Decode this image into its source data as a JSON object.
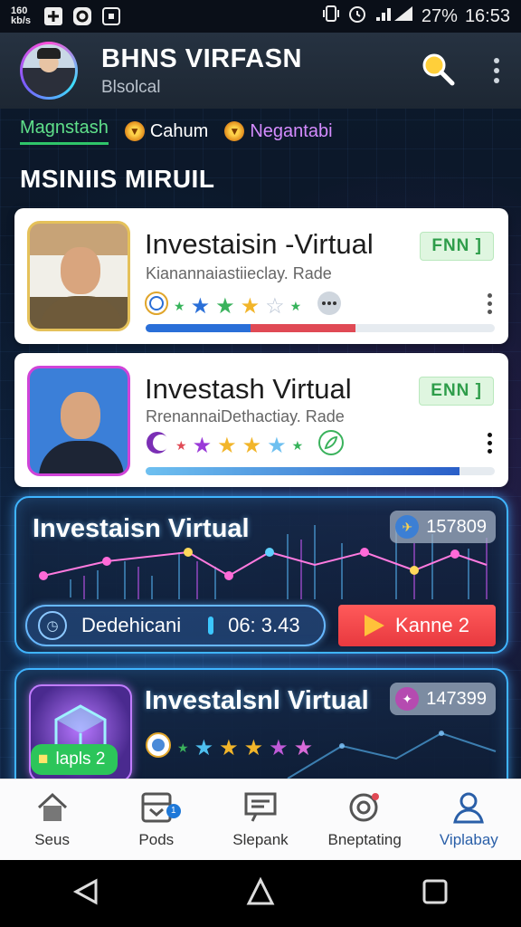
{
  "status_bar": {
    "speed": "160\nkb/s",
    "battery": "27%",
    "time": "16:53"
  },
  "header": {
    "title": "BHNS VIRFASN",
    "subtitle": "Blsolcal"
  },
  "filters": [
    {
      "label": "Magnstash",
      "active": true
    },
    {
      "label": "Cahum",
      "active": false
    },
    {
      "label": "Negantabi",
      "active": false
    }
  ],
  "section_title": "MSINIIS MIRUIL",
  "cards": [
    {
      "title": "Investaisin -Virtual",
      "subtitle": "Kianannaiastiieclay. Rade",
      "badge": "FNN ]",
      "progress": 0.6
    },
    {
      "title": "Investash Virtual",
      "subtitle": "RrenannaiDethactiay. Rade",
      "badge": "ENN ]",
      "progress": 0.9
    }
  ],
  "neon_cards": [
    {
      "title": "Investaisn Virtual",
      "badge_value": "157809",
      "pill_label": "Dedehicani",
      "pill_value": "06: 3.43",
      "button_label": "Kanne 2"
    },
    {
      "title": "Investalsnl Virtual",
      "badge_value": "147399",
      "tag_label": "lapls 2"
    }
  ],
  "bottom_nav": [
    {
      "label": "Seus",
      "icon": "home-icon"
    },
    {
      "label": "Pods",
      "icon": "inbox-icon",
      "badge": "1"
    },
    {
      "label": "Slepank",
      "icon": "chat-icon"
    },
    {
      "label": "Bneptating",
      "icon": "target-icon"
    },
    {
      "label": "Viplabay",
      "icon": "user-icon",
      "active": true
    }
  ],
  "colors": {
    "accent_green": "#2fc56a",
    "neon_blue": "#3fb4ff",
    "button_red": "#e8393f",
    "nav_active": "#2a5fa8"
  }
}
